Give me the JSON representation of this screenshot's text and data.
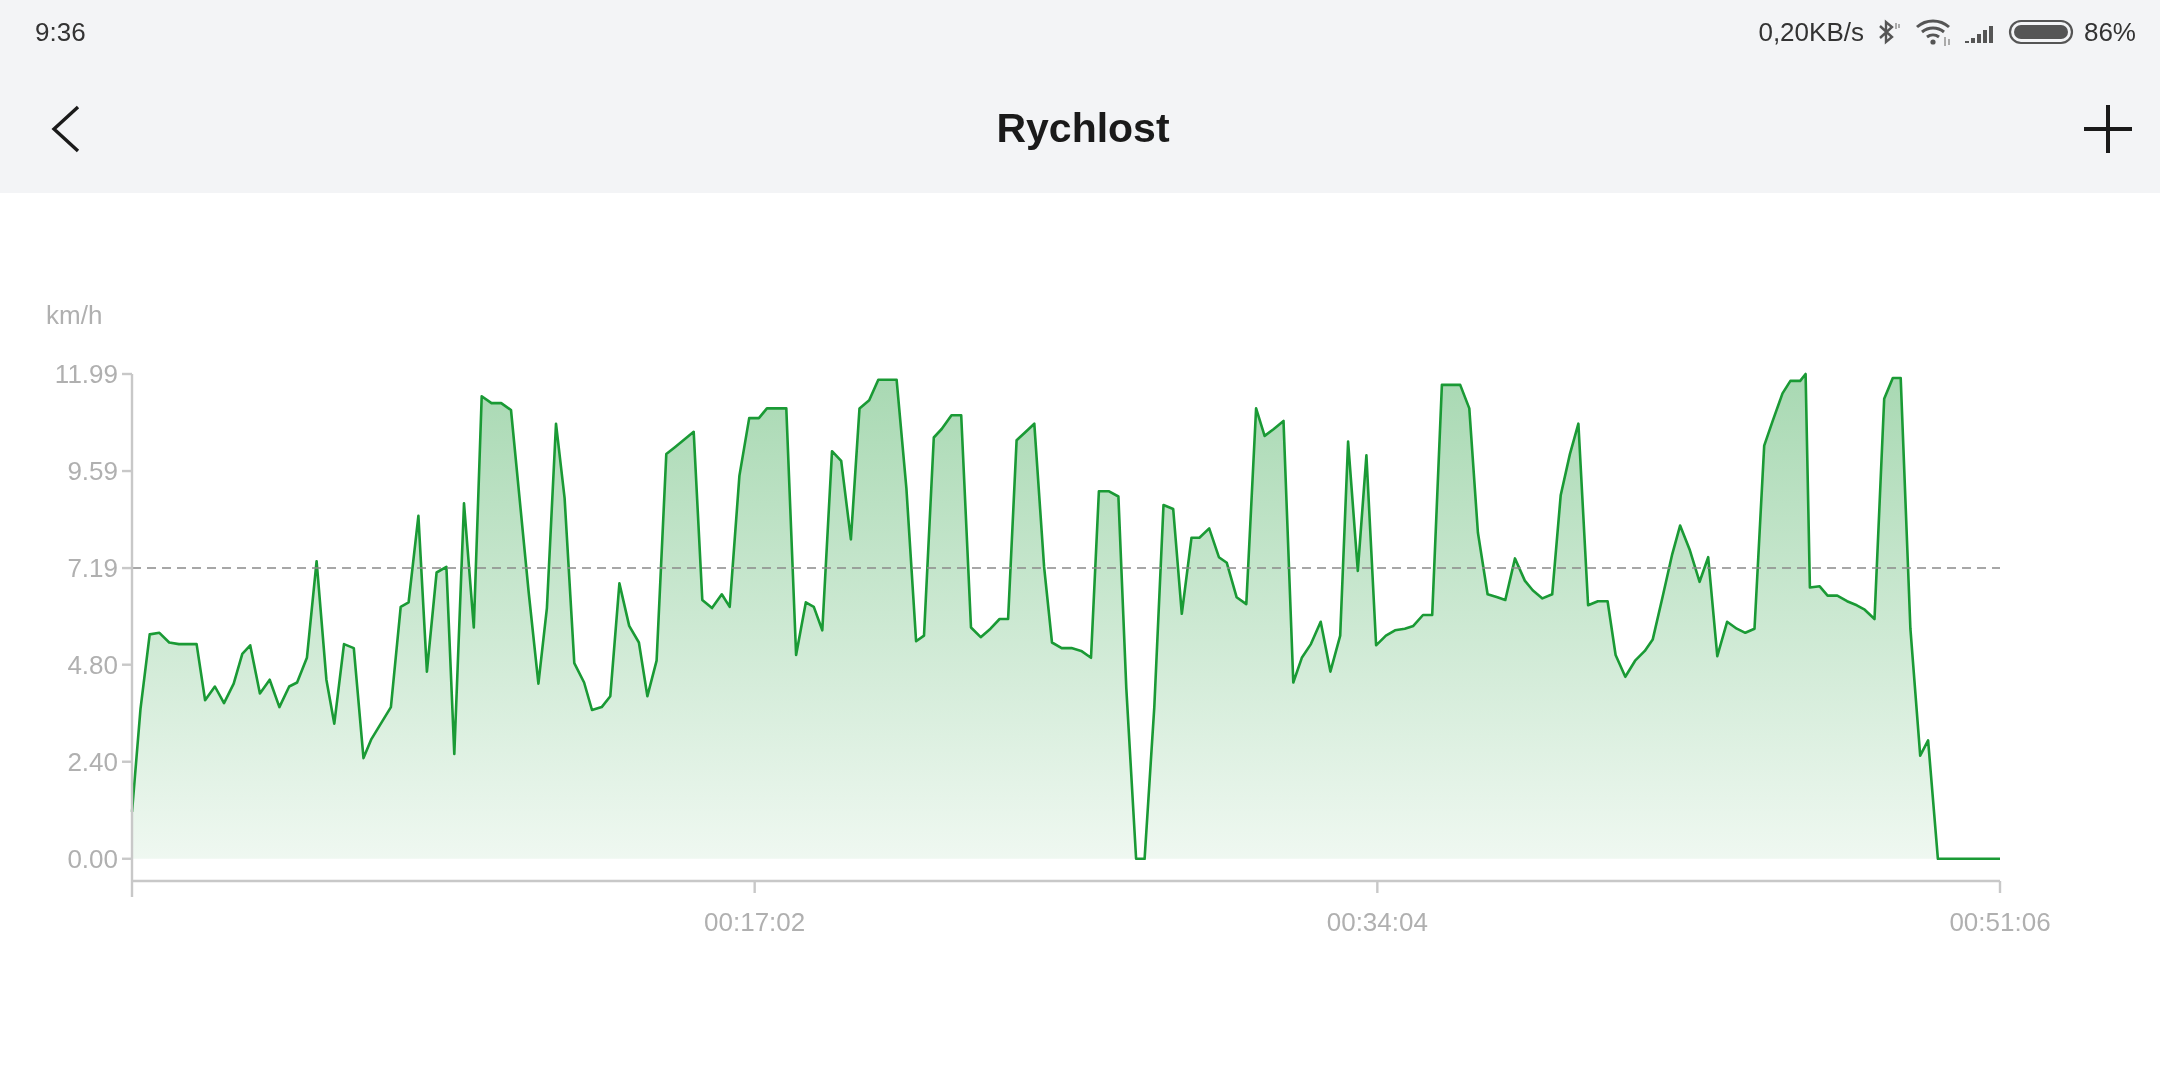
{
  "status_bar": {
    "time": "9:36",
    "network_speed": "0,20KB/s",
    "battery": "86%"
  },
  "header": {
    "title": "Rychlost"
  },
  "chart": {
    "chart_data": {
      "type": "area",
      "ylabel": "km/h",
      "xlim": [
        0,
        3066
      ],
      "ylim": [
        -0.55,
        11.99
      ],
      "yticks": [
        {
          "value": 0,
          "label": "0.00"
        },
        {
          "value": 2.4,
          "label": "2.40"
        },
        {
          "value": 4.8,
          "label": "4.80"
        },
        {
          "value": 7.19,
          "label": "7.19"
        },
        {
          "value": 9.59,
          "label": "9.59"
        },
        {
          "value": 11.99,
          "label": "11.99"
        }
      ],
      "xticks": [
        {
          "value": 1022,
          "label": "00:17:02"
        },
        {
          "value": 2044,
          "label": "00:34:04"
        },
        {
          "value": 3066,
          "label": "00:51:06"
        }
      ],
      "ref_lines": [
        {
          "axis": "y",
          "value": 7.19
        }
      ],
      "x": [
        0,
        14,
        29,
        45,
        61,
        77,
        106,
        120,
        136,
        151,
        167,
        181,
        194,
        210,
        226,
        242,
        258,
        271,
        287,
        303,
        319,
        332,
        348,
        364,
        380,
        393,
        425,
        441,
        454,
        470,
        484,
        500,
        516,
        529,
        545,
        561,
        574,
        590,
        606,
        622,
        651,
        667,
        681,
        696,
        710,
        726,
        742,
        755,
        771,
        785,
        800,
        816,
        832,
        846,
        861,
        877,
        891,
        922,
        936,
        952,
        968,
        981,
        997,
        1013,
        1029,
        1042,
        1074,
        1090,
        1106,
        1119,
        1133,
        1149,
        1164,
        1180,
        1194,
        1210,
        1225,
        1255,
        1271,
        1287,
        1300,
        1316,
        1329,
        1345,
        1361,
        1377,
        1393,
        1409,
        1424,
        1438,
        1452,
        1467,
        1481,
        1497,
        1510,
        1526,
        1542,
        1558,
        1574,
        1587,
        1603,
        1619,
        1632,
        1648,
        1662,
        1678,
        1693,
        1709,
        1723,
        1739,
        1752,
        1768,
        1784,
        1797,
        1813,
        1829,
        1845,
        1859,
        1874,
        1890,
        1906,
        1920,
        1935,
        1951,
        1967,
        1983,
        1996,
        2012,
        2026,
        2042,
        2058,
        2073,
        2089,
        2103,
        2119,
        2134,
        2150,
        2180,
        2195,
        2209,
        2225,
        2241,
        2254,
        2270,
        2286,
        2299,
        2315,
        2331,
        2345,
        2360,
        2374,
        2390,
        2406,
        2422,
        2435,
        2451,
        2467,
        2483,
        2496,
        2512,
        2528,
        2541,
        2557,
        2573,
        2587,
        2602,
        2618,
        2634,
        2648,
        2663,
        2679,
        2693,
        2709,
        2722,
        2738,
        2747,
        2754,
        2770,
        2783,
        2799,
        2815,
        2831,
        2844,
        2860,
        2876,
        2890,
        2903,
        2919,
        2935,
        2948,
        2964,
        3066
      ],
      "series": [
        {
          "color": "#1a9a35",
          "values": [
            1.16,
            3.71,
            5.55,
            5.59,
            5.35,
            5.31,
            5.31,
            3.92,
            4.26,
            3.85,
            4.33,
            5.07,
            5.28,
            4.09,
            4.43,
            3.75,
            4.26,
            4.36,
            4.97,
            7.36,
            4.43,
            3.34,
            5.31,
            5.21,
            2.49,
            2.96,
            3.75,
            6.23,
            6.34,
            8.48,
            4.63,
            7.08,
            7.22,
            2.59,
            8.79,
            5.72,
            11.44,
            11.27,
            11.27,
            11.1,
            6.61,
            4.33,
            6.2,
            10.76,
            8.92,
            4.84,
            4.36,
            3.68,
            3.75,
            4.02,
            6.81,
            5.76,
            5.35,
            4.02,
            4.9,
            10.01,
            10.18,
            10.56,
            6.4,
            6.2,
            6.54,
            6.23,
            9.47,
            10.9,
            10.9,
            11.14,
            11.14,
            5.04,
            6.34,
            6.23,
            5.65,
            10.08,
            9.84,
            7.9,
            11.14,
            11.34,
            11.85,
            11.85,
            9.16,
            5.38,
            5.52,
            10.42,
            10.63,
            10.97,
            10.97,
            5.72,
            5.48,
            5.69,
            5.93,
            5.93,
            10.35,
            10.56,
            10.76,
            7.22,
            5.35,
            5.21,
            5.21,
            5.14,
            4.97,
            9.09,
            9.09,
            8.96,
            4.22,
            0,
            0,
            3.75,
            8.75,
            8.65,
            6.06,
            7.94,
            7.94,
            8.17,
            7.46,
            7.32,
            6.47,
            6.3,
            11.14,
            10.46,
            10.63,
            10.83,
            4.36,
            4.97,
            5.31,
            5.86,
            4.63,
            5.52,
            10.32,
            7.12,
            9.98,
            5.28,
            5.52,
            5.65,
            5.69,
            5.76,
            6.03,
            6.03,
            11.72,
            11.72,
            11.14,
            8.07,
            6.54,
            6.47,
            6.4,
            7.43,
            6.88,
            6.64,
            6.44,
            6.54,
            8.99,
            10.01,
            10.76,
            6.27,
            6.37,
            6.37,
            5.04,
            4.5,
            4.9,
            5.14,
            5.42,
            6.47,
            7.53,
            8.24,
            7.63,
            6.85,
            7.46,
            5.01,
            5.86,
            5.69,
            5.59,
            5.69,
            10.22,
            10.83,
            11.51,
            11.82,
            11.82,
            11.99,
            6.71,
            6.74,
            6.51,
            6.51,
            6.37,
            6.27,
            6.16,
            5.93,
            11.38,
            11.89,
            11.89,
            5.69,
            2.55,
            2.93,
            0,
            0
          ]
        }
      ]
    }
  }
}
